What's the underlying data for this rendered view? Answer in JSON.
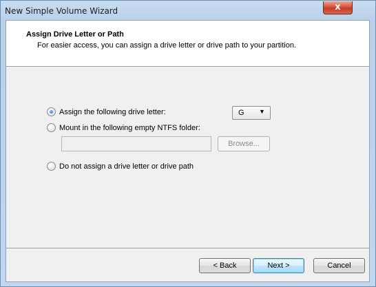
{
  "window": {
    "title": "New Simple Volume Wizard",
    "close_glyph": "x"
  },
  "header": {
    "title": "Assign Drive Letter or Path",
    "subtitle": "For easier access, you can assign a drive letter or drive path to your partition."
  },
  "options": {
    "assign_letter": {
      "label": "Assign the following drive letter:",
      "checked": true
    },
    "mount_folder": {
      "label": "Mount in the following empty NTFS folder:",
      "checked": false
    },
    "no_assign": {
      "label": "Do not assign a drive letter or drive path",
      "checked": false
    }
  },
  "drive_letter": {
    "selected": "G",
    "arrow": "▼"
  },
  "folder_path": {
    "value": ""
  },
  "buttons": {
    "browse": "Browse...",
    "back": "< Back",
    "next": "Next >",
    "cancel": "Cancel"
  }
}
